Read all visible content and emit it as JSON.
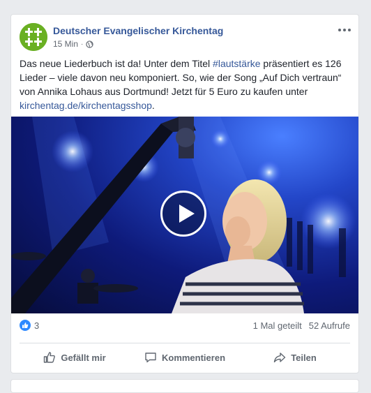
{
  "post": {
    "page_name": "Deutscher Evangelischer Kirchentag",
    "time": "15 Min",
    "separator": "·",
    "text_part1": "Das neue Liederbuch ist da! Unter dem Titel ",
    "hashtag": "#lautstärke",
    "text_part2": " präsentiert es 126 Lieder – viele davon neu komponiert. So, wie der Song „Auf Dich vertraun“ von Annika Lohaus aus Dortmund! Jetzt für 5 Euro zu kaufen unter ",
    "link": "kirchentag.de/kirchentagsshop",
    "text_end": "."
  },
  "stats": {
    "like_count": "3",
    "shares": "1 Mal geteilt",
    "views": "52 Aufrufe"
  },
  "actions": {
    "like": "Gefällt mir",
    "comment": "Kommentieren",
    "share": "Teilen"
  },
  "colors": {
    "brand_green": "#6ab023",
    "link_blue": "#365899",
    "like_blue": "#2e89ff"
  },
  "icons": [
    "globe-icon",
    "more-icon",
    "play-icon",
    "like-icon",
    "thumbs-up-icon",
    "comment-icon",
    "share-icon"
  ]
}
